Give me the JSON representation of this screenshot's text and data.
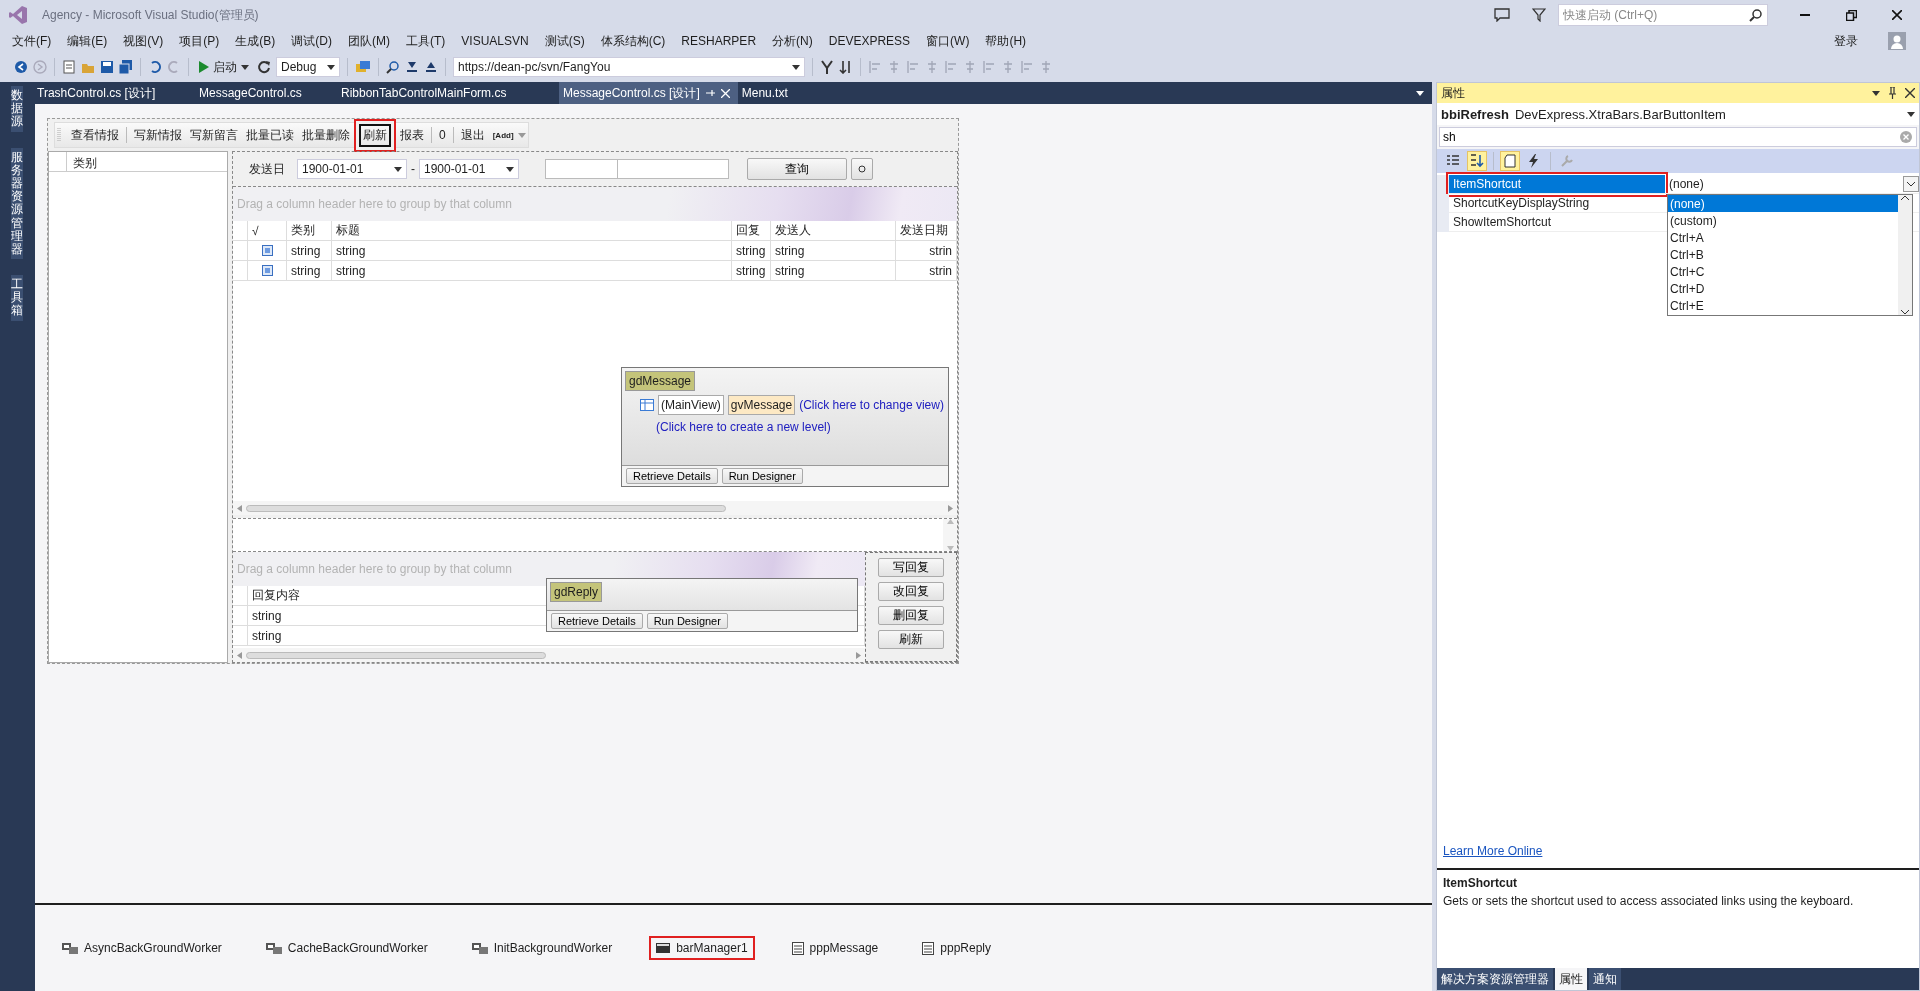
{
  "window": {
    "title": "Agency - Microsoft Visual Studio(管理员)"
  },
  "quick_launch": {
    "placeholder": "快速启动 (Ctrl+Q)"
  },
  "account": {
    "label": "登录"
  },
  "menu": [
    "文件(F)",
    "编辑(E)",
    "视图(V)",
    "项目(P)",
    "生成(B)",
    "调试(D)",
    "团队(M)",
    "工具(T)",
    "VISUALSVN",
    "测试(S)",
    "体系结构(C)",
    "RESHARPER",
    "分析(N)",
    "DEVEXPRESS",
    "窗口(W)",
    "帮助(H)"
  ],
  "toolbar": {
    "start_label": "启动",
    "configuration": "Debug",
    "svn_url": "https://dean-pc/svn/FangYou"
  },
  "side_tabs": [
    "数据源",
    "服务器资源管理器",
    "工具箱"
  ],
  "document_tabs": [
    {
      "label": "TrashControl.cs [设计]",
      "selected": false
    },
    {
      "label": "MessageControl.cs",
      "selected": false
    },
    {
      "label": "RibbonTabControlMainForm.cs",
      "selected": false
    },
    {
      "label": "MessageControl.cs [设计]",
      "selected": true
    },
    {
      "label": "Menu.txt",
      "selected": false
    }
  ],
  "form_toolbar": {
    "items": [
      {
        "label": "查看情报",
        "highlighted": false,
        "separator": true
      },
      {
        "label": "写新情报",
        "highlighted": false,
        "separator": false
      },
      {
        "label": "写新留言",
        "highlighted": false,
        "separator": false
      },
      {
        "label": "批量已读",
        "highlighted": false,
        "separator": false
      },
      {
        "label": "批量删除",
        "highlighted": false,
        "separator": false
      },
      {
        "label": "刷新",
        "highlighted": true,
        "separator": false
      },
      {
        "label": "报表",
        "highlighted": false,
        "separator": true
      },
      {
        "label": "0",
        "highlighted": false,
        "separator": true
      },
      {
        "label": "退出",
        "highlighted": false,
        "separator": false
      }
    ],
    "add_label": "[Add]"
  },
  "category_panel": {
    "header": "类别"
  },
  "filter": {
    "label": "发送日",
    "date_from": "1900-01-01",
    "dash": "-",
    "date_to": "1900-01-01",
    "search_button": "查询"
  },
  "message_grid": {
    "group_hint": "Drag a column header here to group by that column",
    "check_column": "√",
    "columns": [
      "类别",
      "标题",
      "回复",
      "发送人",
      "发送日期"
    ],
    "rows": [
      [
        "string",
        "string",
        "string",
        "string",
        "strin"
      ],
      [
        "string",
        "string",
        "string",
        "string",
        "strin"
      ]
    ]
  },
  "message_designer": {
    "name": "gdMessage",
    "main_view": "(MainView)",
    "view_name": "gvMessage",
    "change_view_link": "(Click here to change view)",
    "new_level_link": "(Click here to create a new level)",
    "buttons": [
      "Retrieve Details",
      "Run Designer"
    ]
  },
  "reply_grid": {
    "group_hint": "Drag a column header here to group by that column",
    "column": "回复内容",
    "rows": [
      "string",
      "string"
    ]
  },
  "reply_designer": {
    "name": "gdReply",
    "buttons": [
      "Retrieve Details",
      "Run Designer"
    ]
  },
  "reply_buttons": [
    "写回复",
    "改回复",
    "删回复",
    "刷新"
  ],
  "component_tray": [
    {
      "label": "AsyncBackGroundWorker",
      "kind": "worker",
      "selected": false
    },
    {
      "label": "CacheBackGroundWorker",
      "kind": "worker",
      "selected": false
    },
    {
      "label": "InitBackgroundWorker",
      "kind": "worker",
      "selected": false
    },
    {
      "label": "barManager1",
      "kind": "bar-manager",
      "selected": true
    },
    {
      "label": "pppMessage",
      "kind": "printing",
      "selected": false
    },
    {
      "label": "pppReply",
      "kind": "printing",
      "selected": false
    }
  ],
  "properties": {
    "title": "属性",
    "object_name": "bbiRefresh",
    "object_type": "DevExpress.XtraBars.BarButtonItem",
    "search": "sh",
    "rows": [
      {
        "name": "ItemShortcut",
        "value": "(none)",
        "selected": true
      },
      {
        "name": "ShortcutKeyDisplayString",
        "selected": false
      },
      {
        "name": "ShowItemShortcut",
        "selected": false
      }
    ],
    "dropdown": [
      {
        "label": "(none)",
        "selected": true
      },
      {
        "label": "(custom)",
        "selected": false
      },
      {
        "label": "Ctrl+A",
        "selected": false
      },
      {
        "label": "Ctrl+B",
        "selected": false
      },
      {
        "label": "Ctrl+C",
        "selected": false
      },
      {
        "label": "Ctrl+D",
        "selected": false
      },
      {
        "label": "Ctrl+E",
        "selected": false
      }
    ],
    "link": "Learn More Online",
    "description_title": "ItemShortcut",
    "description": "Gets or sets the shortcut used to access associated links using the keyboard."
  },
  "bottom_tabs": [
    {
      "label": "解决方案资源管理器",
      "selected": false
    },
    {
      "label": "属性",
      "selected": true
    },
    {
      "label": "通知",
      "selected": false
    }
  ]
}
